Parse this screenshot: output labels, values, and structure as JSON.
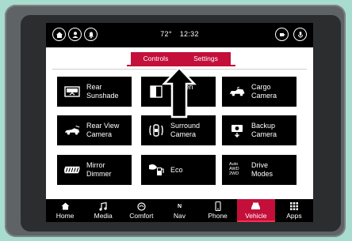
{
  "status": {
    "temperature": "72°",
    "time": "12:32"
  },
  "tabs": [
    {
      "label": "Controls"
    },
    {
      "label": "Settings"
    }
  ],
  "tiles": [
    {
      "line1": "Rear",
      "line2": "Sunshade",
      "icon": "sunshade-icon"
    },
    {
      "line1": "",
      "line2": "Screen",
      "icon": "screen-icon"
    },
    {
      "line1": "Cargo",
      "line2": "Camera",
      "icon": "cargo-camera-icon"
    },
    {
      "line1": "Rear View",
      "line2": "Camera",
      "icon": "rear-view-camera-icon"
    },
    {
      "line1": "Surround",
      "line2": "Camera",
      "icon": "surround-camera-icon"
    },
    {
      "line1": "Backup",
      "line2": "Camera",
      "icon": "backup-camera-icon"
    },
    {
      "line1": "Mirror",
      "line2": "Dimmer",
      "icon": "mirror-dimmer-icon"
    },
    {
      "line1": "Eco",
      "line2": "",
      "icon": "eco-icon"
    },
    {
      "line1": "Drive",
      "line2": "Modes",
      "icon": "drive-modes-icon",
      "icon_text": [
        "Auto",
        "AWD",
        "2WD"
      ]
    }
  ],
  "nav": [
    {
      "label": "Home",
      "icon": "home-icon"
    },
    {
      "label": "Media",
      "icon": "music-note-icon"
    },
    {
      "label": "Comfort",
      "icon": "comfort-icon"
    },
    {
      "label": "Nav",
      "icon": "compass-icon",
      "glyph": "N"
    },
    {
      "label": "Phone",
      "icon": "phone-icon"
    },
    {
      "label": "Vehicle",
      "icon": "vehicle-icon"
    },
    {
      "label": "Apps",
      "icon": "apps-grid-icon"
    }
  ],
  "colors": {
    "accent": "#c30f3a",
    "screen_bg": "#ffffff",
    "bar_bg": "#000000"
  }
}
